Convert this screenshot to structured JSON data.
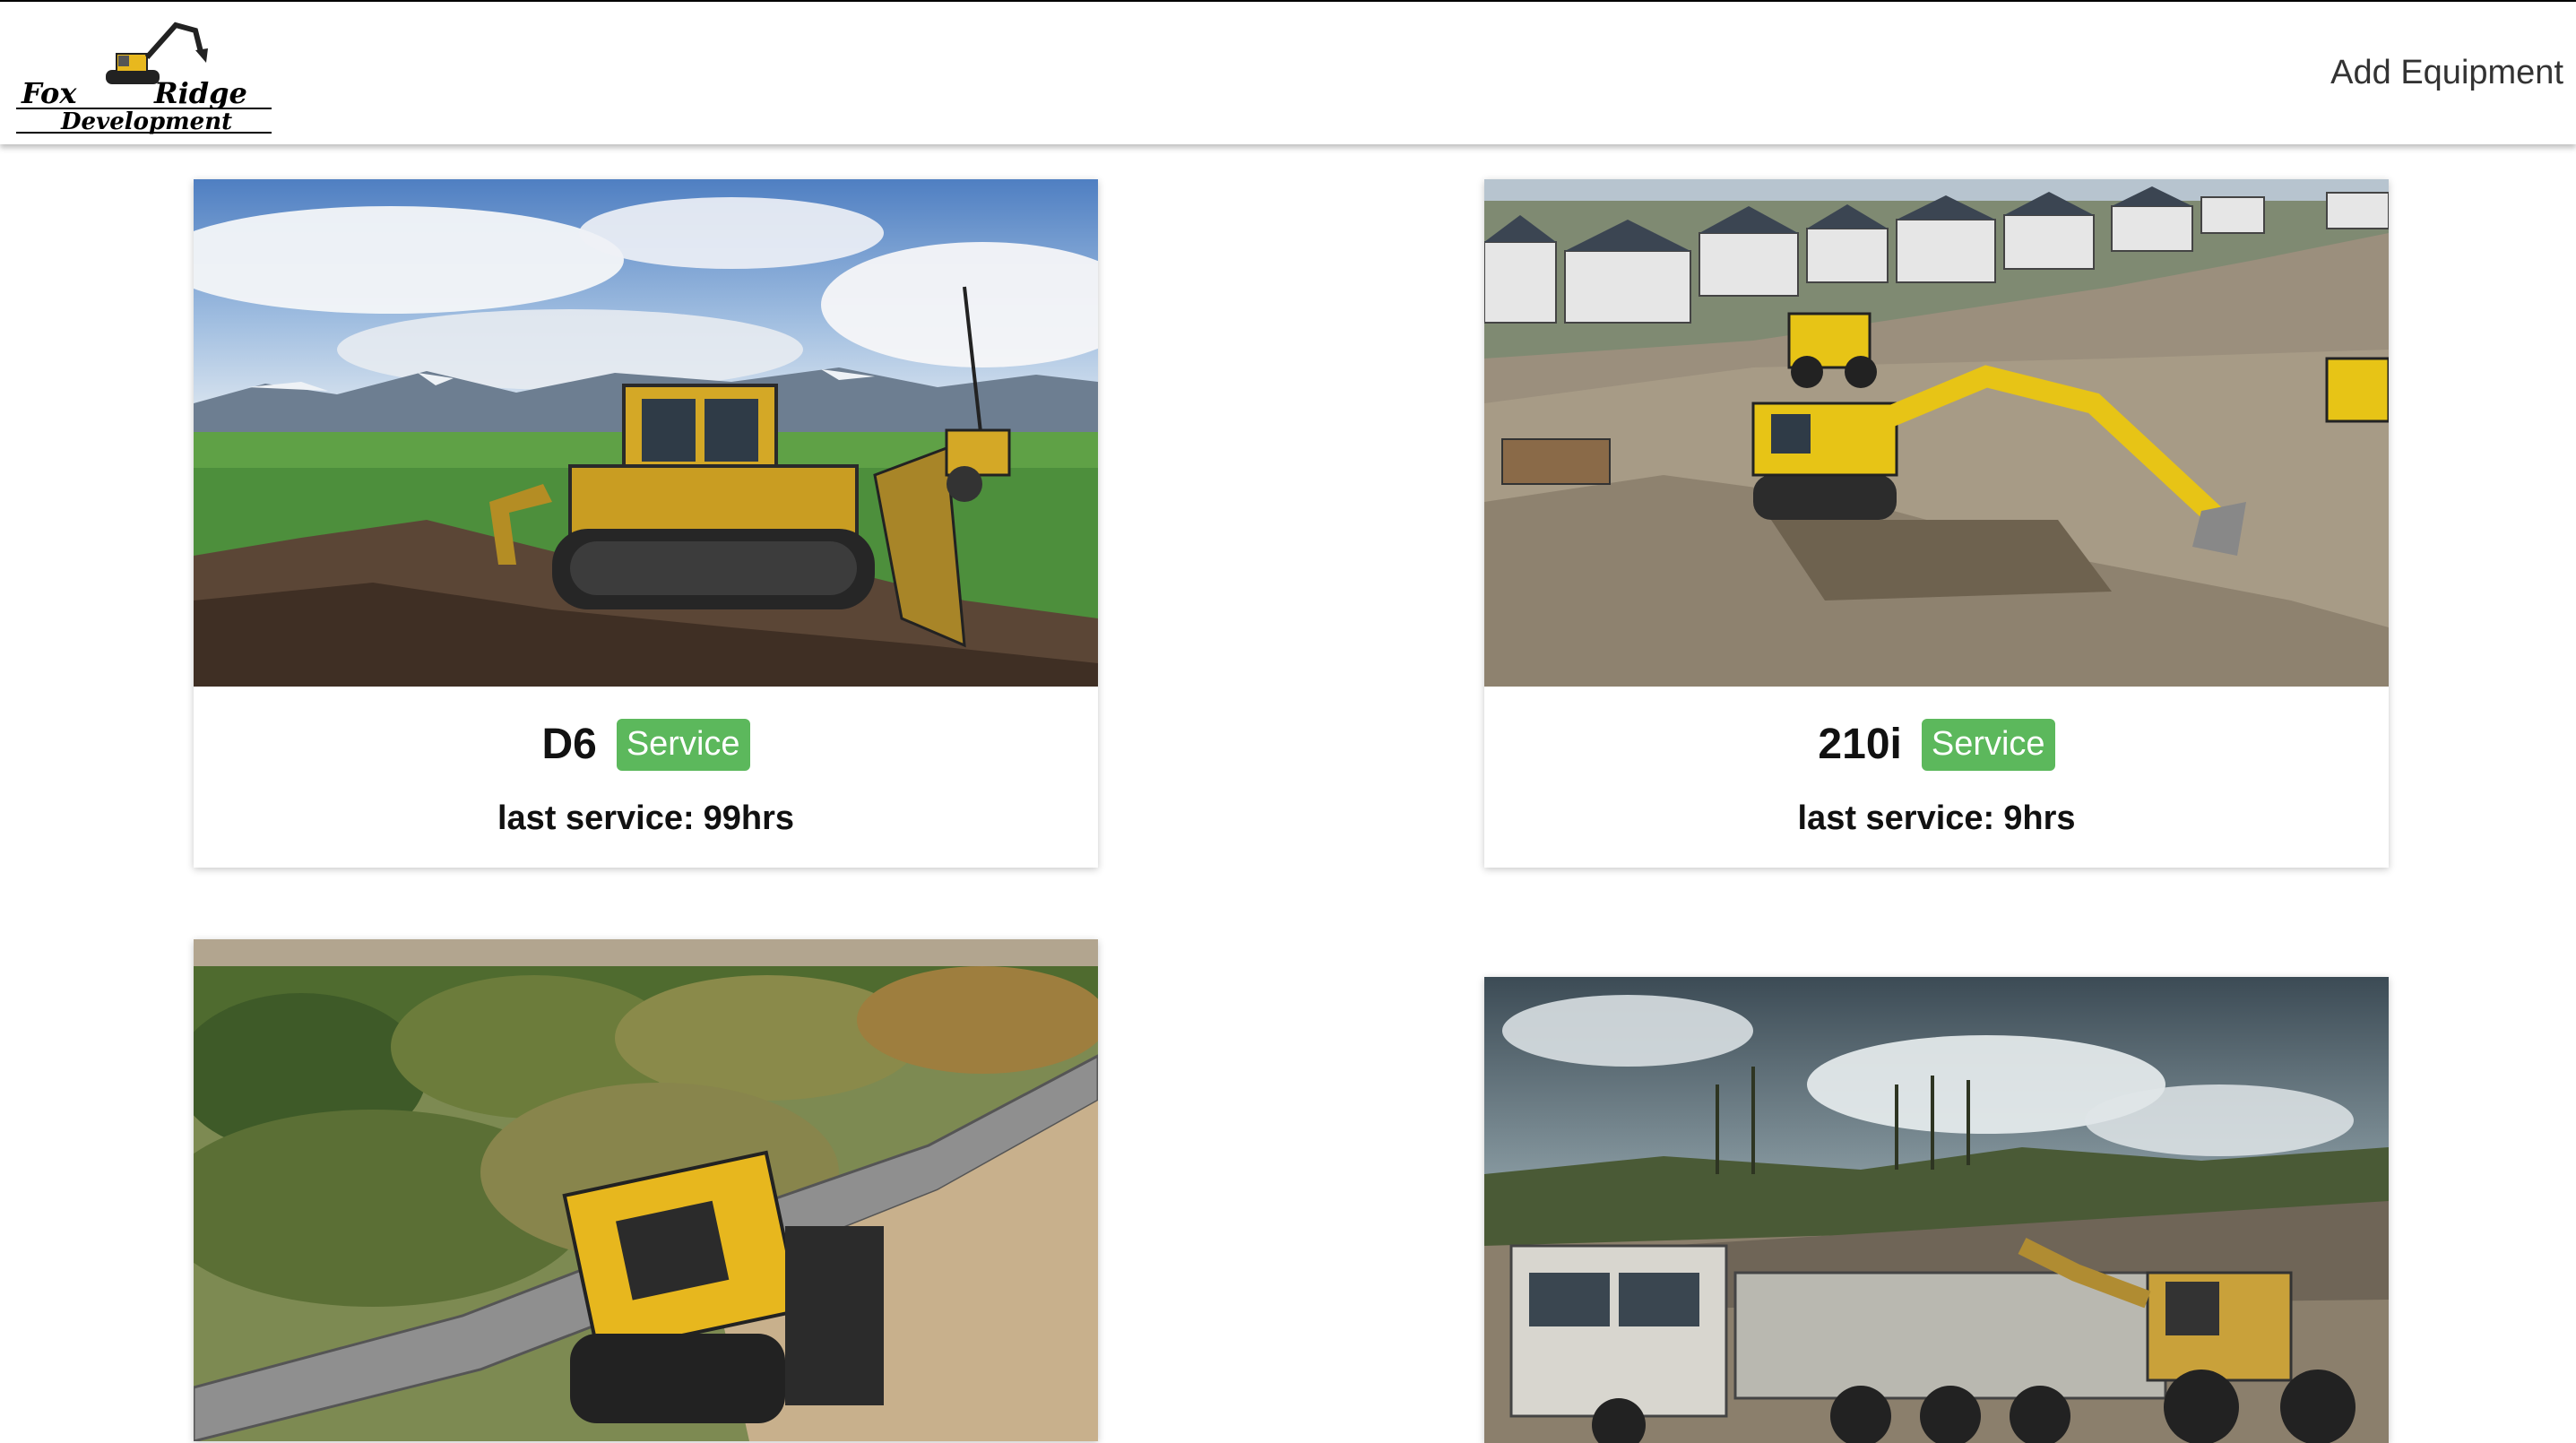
{
  "brand": {
    "name_line1_left": "Fox",
    "name_line1_right": "Ridge",
    "name_line2": "Development",
    "logo_icon": "excavator-icon"
  },
  "nav": {
    "add_equipment_label": "Add Equipment"
  },
  "equipment": [
    {
      "name": "D6",
      "service_label": "Service",
      "last_service_label": "last service:",
      "last_service_value": "99hrs",
      "photo": "bulldozer-photo"
    },
    {
      "name": "210i",
      "service_label": "Service",
      "last_service_label": "last service:",
      "last_service_value": "9hrs",
      "photo": "excavator-photo"
    },
    {
      "photo": "skid-steer-photo"
    },
    {
      "photo": "loader-truck-photo"
    }
  ],
  "colors": {
    "service_badge": "#5cb85c",
    "brand_yellow": "#e8b81e"
  }
}
